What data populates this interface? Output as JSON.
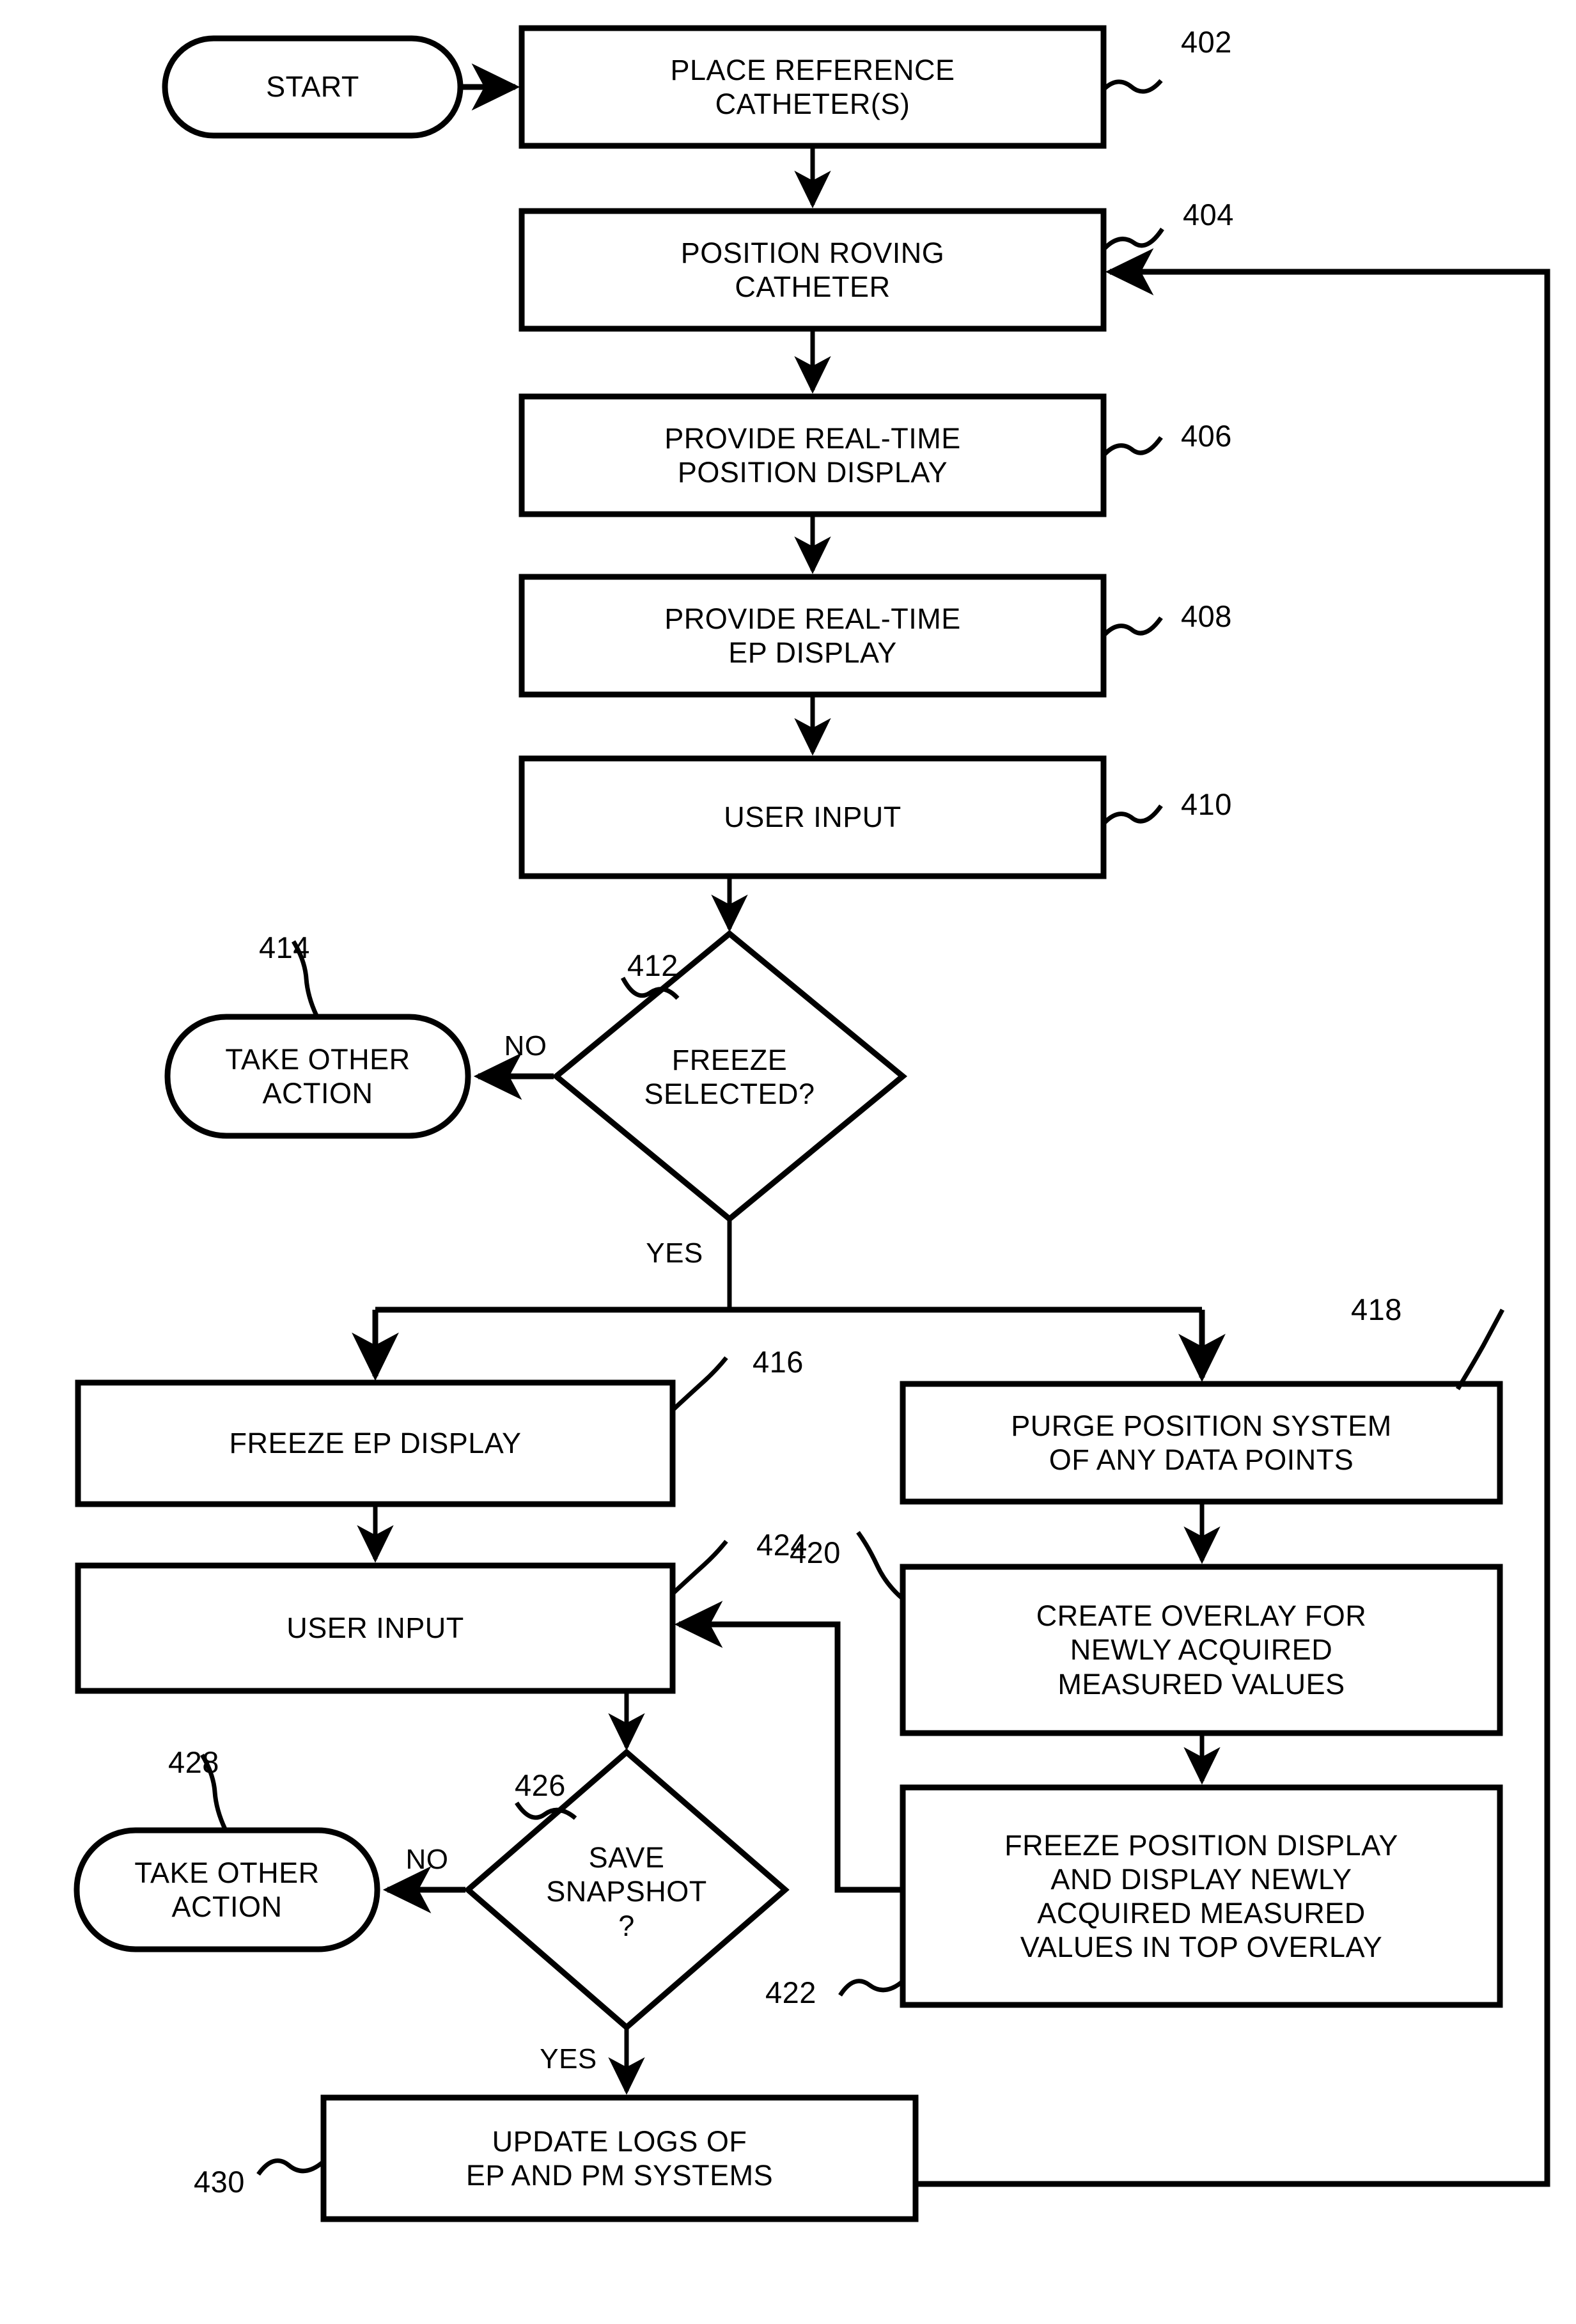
{
  "diagram": {
    "title": "Catheter position / EP display freeze-and-snapshot flowchart",
    "nodes": {
      "start": {
        "ref": "",
        "text": "START",
        "shape": "terminator"
      },
      "n402": {
        "ref": "402",
        "text": "PLACE REFERENCE\nCATHETER(S)",
        "shape": "process"
      },
      "n404": {
        "ref": "404",
        "text": "POSITION ROVING\nCATHETER",
        "shape": "process"
      },
      "n406": {
        "ref": "406",
        "text": "PROVIDE REAL-TIME\nPOSITION DISPLAY",
        "shape": "process"
      },
      "n408": {
        "ref": "408",
        "text": "PROVIDE REAL-TIME\nEP DISPLAY",
        "shape": "process"
      },
      "n410": {
        "ref": "410",
        "text": "USER INPUT",
        "shape": "process"
      },
      "n412": {
        "ref": "412",
        "text": "FREEZE\nSELECTED?",
        "shape": "decision"
      },
      "n414": {
        "ref": "414",
        "text": "TAKE OTHER\nACTION",
        "shape": "terminator"
      },
      "n416": {
        "ref": "416",
        "text": "FREEZE EP DISPLAY",
        "shape": "process"
      },
      "n418": {
        "ref": "418",
        "text": "PURGE POSITION SYSTEM\nOF ANY DATA POINTS",
        "shape": "process"
      },
      "n420": {
        "ref": "420",
        "text": "CREATE OVERLAY FOR\nNEWLY ACQUIRED\nMEASURED VALUES",
        "shape": "process"
      },
      "n422": {
        "ref": "422",
        "text": "FREEZE POSITION DISPLAY\nAND DISPLAY NEWLY\nACQUIRED MEASURED\nVALUES IN TOP OVERLAY",
        "shape": "process"
      },
      "n424": {
        "ref": "424",
        "text": "USER INPUT",
        "shape": "process"
      },
      "n426": {
        "ref": "426",
        "text": "SAVE\nSNAPSHOT\n?",
        "shape": "decision"
      },
      "n428": {
        "ref": "428",
        "text": "TAKE OTHER\nACTION",
        "shape": "terminator"
      },
      "n430": {
        "ref": "430",
        "text": "UPDATE LOGS OF\nEP AND PM SYSTEMS",
        "shape": "process"
      }
    },
    "edge_labels": {
      "e412_no": "NO",
      "e412_yes": "YES",
      "e426_no": "NO",
      "e426_yes": "YES"
    },
    "colors": {
      "stroke": "#000000",
      "fill": "#ffffff",
      "background": "#ffffff"
    }
  }
}
